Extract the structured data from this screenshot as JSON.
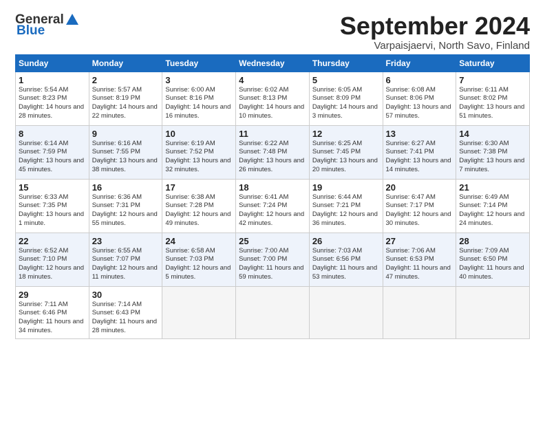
{
  "header": {
    "logo_general": "General",
    "logo_blue": "Blue",
    "month": "September 2024",
    "location": "Varpaisjaervi, North Savo, Finland"
  },
  "weekdays": [
    "Sunday",
    "Monday",
    "Tuesday",
    "Wednesday",
    "Thursday",
    "Friday",
    "Saturday"
  ],
  "weeks": [
    [
      {
        "day": "1",
        "sunrise": "Sunrise: 5:54 AM",
        "sunset": "Sunset: 8:23 PM",
        "daylight": "Daylight: 14 hours and 28 minutes."
      },
      {
        "day": "2",
        "sunrise": "Sunrise: 5:57 AM",
        "sunset": "Sunset: 8:19 PM",
        "daylight": "Daylight: 14 hours and 22 minutes."
      },
      {
        "day": "3",
        "sunrise": "Sunrise: 6:00 AM",
        "sunset": "Sunset: 8:16 PM",
        "daylight": "Daylight: 14 hours and 16 minutes."
      },
      {
        "day": "4",
        "sunrise": "Sunrise: 6:02 AM",
        "sunset": "Sunset: 8:13 PM",
        "daylight": "Daylight: 14 hours and 10 minutes."
      },
      {
        "day": "5",
        "sunrise": "Sunrise: 6:05 AM",
        "sunset": "Sunset: 8:09 PM",
        "daylight": "Daylight: 14 hours and 3 minutes."
      },
      {
        "day": "6",
        "sunrise": "Sunrise: 6:08 AM",
        "sunset": "Sunset: 8:06 PM",
        "daylight": "Daylight: 13 hours and 57 minutes."
      },
      {
        "day": "7",
        "sunrise": "Sunrise: 6:11 AM",
        "sunset": "Sunset: 8:02 PM",
        "daylight": "Daylight: 13 hours and 51 minutes."
      }
    ],
    [
      {
        "day": "8",
        "sunrise": "Sunrise: 6:14 AM",
        "sunset": "Sunset: 7:59 PM",
        "daylight": "Daylight: 13 hours and 45 minutes."
      },
      {
        "day": "9",
        "sunrise": "Sunrise: 6:16 AM",
        "sunset": "Sunset: 7:55 PM",
        "daylight": "Daylight: 13 hours and 38 minutes."
      },
      {
        "day": "10",
        "sunrise": "Sunrise: 6:19 AM",
        "sunset": "Sunset: 7:52 PM",
        "daylight": "Daylight: 13 hours and 32 minutes."
      },
      {
        "day": "11",
        "sunrise": "Sunrise: 6:22 AM",
        "sunset": "Sunset: 7:48 PM",
        "daylight": "Daylight: 13 hours and 26 minutes."
      },
      {
        "day": "12",
        "sunrise": "Sunrise: 6:25 AM",
        "sunset": "Sunset: 7:45 PM",
        "daylight": "Daylight: 13 hours and 20 minutes."
      },
      {
        "day": "13",
        "sunrise": "Sunrise: 6:27 AM",
        "sunset": "Sunset: 7:41 PM",
        "daylight": "Daylight: 13 hours and 14 minutes."
      },
      {
        "day": "14",
        "sunrise": "Sunrise: 6:30 AM",
        "sunset": "Sunset: 7:38 PM",
        "daylight": "Daylight: 13 hours and 7 minutes."
      }
    ],
    [
      {
        "day": "15",
        "sunrise": "Sunrise: 6:33 AM",
        "sunset": "Sunset: 7:35 PM",
        "daylight": "Daylight: 13 hours and 1 minute."
      },
      {
        "day": "16",
        "sunrise": "Sunrise: 6:36 AM",
        "sunset": "Sunset: 7:31 PM",
        "daylight": "Daylight: 12 hours and 55 minutes."
      },
      {
        "day": "17",
        "sunrise": "Sunrise: 6:38 AM",
        "sunset": "Sunset: 7:28 PM",
        "daylight": "Daylight: 12 hours and 49 minutes."
      },
      {
        "day": "18",
        "sunrise": "Sunrise: 6:41 AM",
        "sunset": "Sunset: 7:24 PM",
        "daylight": "Daylight: 12 hours and 42 minutes."
      },
      {
        "day": "19",
        "sunrise": "Sunrise: 6:44 AM",
        "sunset": "Sunset: 7:21 PM",
        "daylight": "Daylight: 12 hours and 36 minutes."
      },
      {
        "day": "20",
        "sunrise": "Sunrise: 6:47 AM",
        "sunset": "Sunset: 7:17 PM",
        "daylight": "Daylight: 12 hours and 30 minutes."
      },
      {
        "day": "21",
        "sunrise": "Sunrise: 6:49 AM",
        "sunset": "Sunset: 7:14 PM",
        "daylight": "Daylight: 12 hours and 24 minutes."
      }
    ],
    [
      {
        "day": "22",
        "sunrise": "Sunrise: 6:52 AM",
        "sunset": "Sunset: 7:10 PM",
        "daylight": "Daylight: 12 hours and 18 minutes."
      },
      {
        "day": "23",
        "sunrise": "Sunrise: 6:55 AM",
        "sunset": "Sunset: 7:07 PM",
        "daylight": "Daylight: 12 hours and 11 minutes."
      },
      {
        "day": "24",
        "sunrise": "Sunrise: 6:58 AM",
        "sunset": "Sunset: 7:03 PM",
        "daylight": "Daylight: 12 hours and 5 minutes."
      },
      {
        "day": "25",
        "sunrise": "Sunrise: 7:00 AM",
        "sunset": "Sunset: 7:00 PM",
        "daylight": "Daylight: 11 hours and 59 minutes."
      },
      {
        "day": "26",
        "sunrise": "Sunrise: 7:03 AM",
        "sunset": "Sunset: 6:56 PM",
        "daylight": "Daylight: 11 hours and 53 minutes."
      },
      {
        "day": "27",
        "sunrise": "Sunrise: 7:06 AM",
        "sunset": "Sunset: 6:53 PM",
        "daylight": "Daylight: 11 hours and 47 minutes."
      },
      {
        "day": "28",
        "sunrise": "Sunrise: 7:09 AM",
        "sunset": "Sunset: 6:50 PM",
        "daylight": "Daylight: 11 hours and 40 minutes."
      }
    ],
    [
      {
        "day": "29",
        "sunrise": "Sunrise: 7:11 AM",
        "sunset": "Sunset: 6:46 PM",
        "daylight": "Daylight: 11 hours and 34 minutes."
      },
      {
        "day": "30",
        "sunrise": "Sunrise: 7:14 AM",
        "sunset": "Sunset: 6:43 PM",
        "daylight": "Daylight: 11 hours and 28 minutes."
      },
      {
        "day": "",
        "sunrise": "",
        "sunset": "",
        "daylight": ""
      },
      {
        "day": "",
        "sunrise": "",
        "sunset": "",
        "daylight": ""
      },
      {
        "day": "",
        "sunrise": "",
        "sunset": "",
        "daylight": ""
      },
      {
        "day": "",
        "sunrise": "",
        "sunset": "",
        "daylight": ""
      },
      {
        "day": "",
        "sunrise": "",
        "sunset": "",
        "daylight": ""
      }
    ]
  ]
}
